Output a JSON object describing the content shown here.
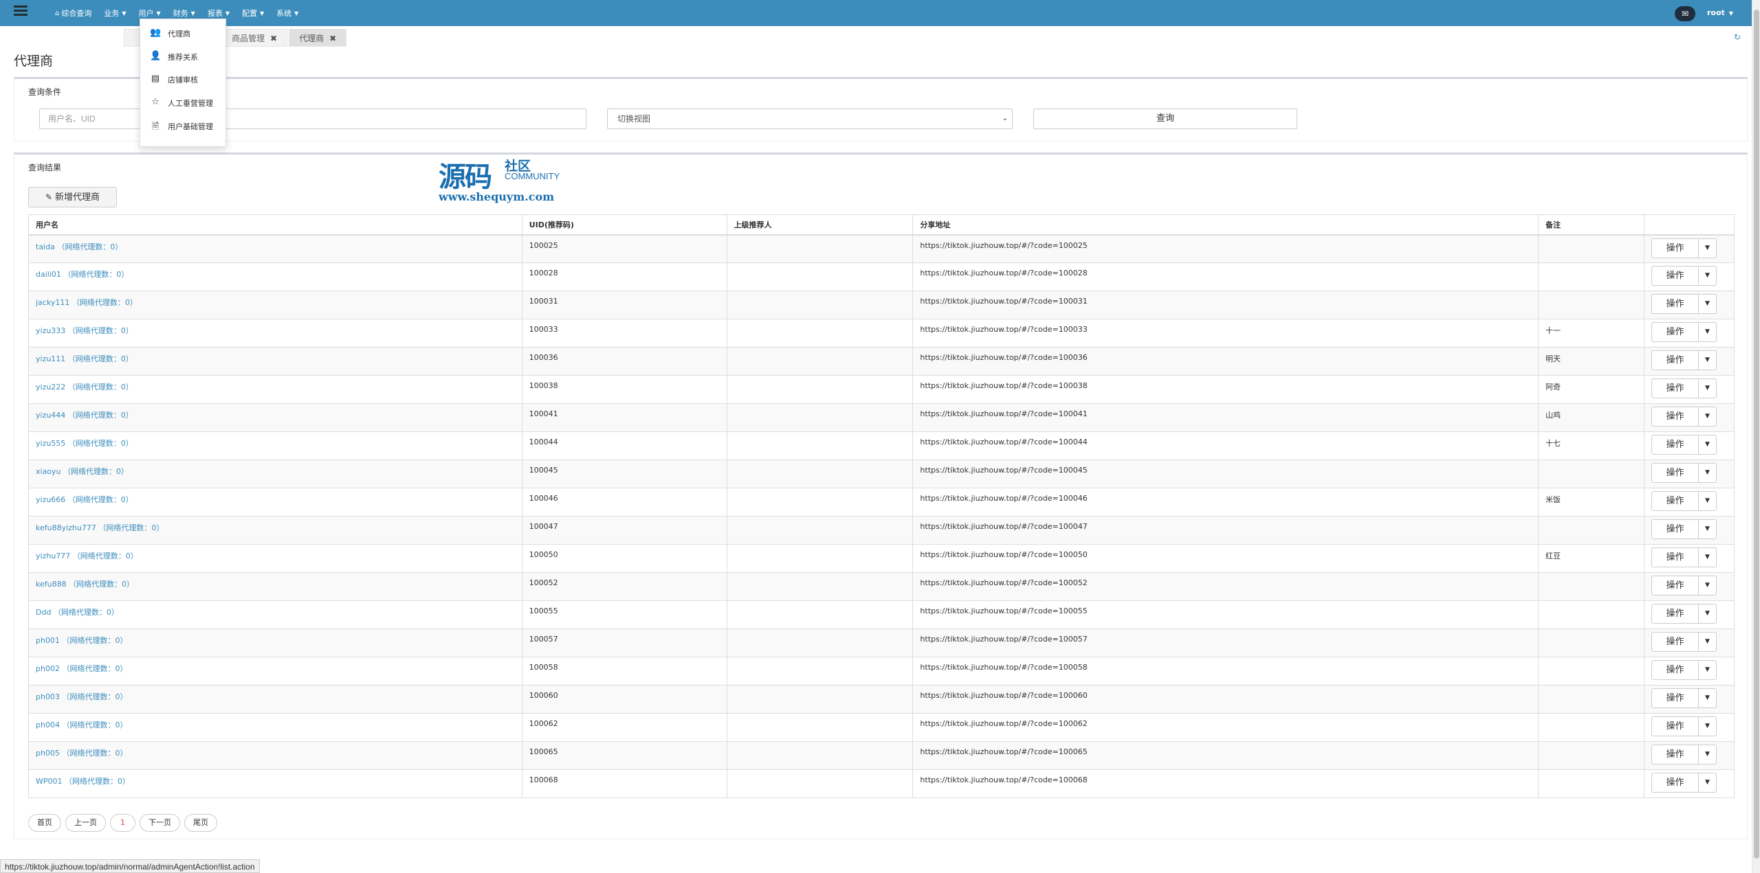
{
  "colors": {
    "topbar": "#3c8dbc",
    "link": "#3c8dbc",
    "current_page": "#e84a3d"
  },
  "topbar": {
    "menu": [
      {
        "label": "综合查询",
        "icon": "home-icon"
      },
      {
        "label": "业务"
      },
      {
        "label": "用户"
      },
      {
        "label": "财务"
      },
      {
        "label": "报表"
      },
      {
        "label": "配置"
      },
      {
        "label": "系统"
      }
    ],
    "user": "root"
  },
  "tabs": [
    {
      "label": "商品管理"
    },
    {
      "label": "代理商"
    }
  ],
  "dropdown": [
    {
      "label": "代理商",
      "icon": "users-icon"
    },
    {
      "label": "推荐关系",
      "icon": "user-icon"
    },
    {
      "label": "店铺审核",
      "icon": "card-icon"
    },
    {
      "label": "人工垂营管理",
      "icon": "star-icon"
    },
    {
      "label": "用户基础管理",
      "icon": "file-icon"
    }
  ],
  "page_title": "代理商",
  "search": {
    "title": "查询条件",
    "placeholder": "用户名、UID",
    "select_value": "切换视图",
    "query_label": "查询"
  },
  "results": {
    "title": "查询结果",
    "add_label": "新增代理商",
    "columns": [
      "用户名",
      "UID(推荐码)",
      "上级推荐人",
      "分享地址",
      "备注",
      ""
    ],
    "op_label": "操作",
    "rows": [
      {
        "name": "taida （网络代理数：0）",
        "uid": "100025",
        "parent": "",
        "url": "https://tiktok.jiuzhouw.top/#/?code=100025",
        "note": ""
      },
      {
        "name": "daili01 （网络代理数：0）",
        "uid": "100028",
        "parent": "",
        "url": "https://tiktok.jiuzhouw.top/#/?code=100028",
        "note": ""
      },
      {
        "name": "jacky111 （网络代理数：0）",
        "uid": "100031",
        "parent": "",
        "url": "https://tiktok.jiuzhouw.top/#/?code=100031",
        "note": ""
      },
      {
        "name": "yizu333 （网络代理数：0）",
        "uid": "100033",
        "parent": "",
        "url": "https://tiktok.jiuzhouw.top/#/?code=100033",
        "note": "十一"
      },
      {
        "name": "yizu111 （网络代理数：0）",
        "uid": "100036",
        "parent": "",
        "url": "https://tiktok.jiuzhouw.top/#/?code=100036",
        "note": "明天"
      },
      {
        "name": "yizu222 （网络代理数：0）",
        "uid": "100038",
        "parent": "",
        "url": "https://tiktok.jiuzhouw.top/#/?code=100038",
        "note": "阿奇"
      },
      {
        "name": "yizu444 （网络代理数：0）",
        "uid": "100041",
        "parent": "",
        "url": "https://tiktok.jiuzhouw.top/#/?code=100041",
        "note": "山鸡"
      },
      {
        "name": "yizu555 （网络代理数：0）",
        "uid": "100044",
        "parent": "",
        "url": "https://tiktok.jiuzhouw.top/#/?code=100044",
        "note": "十七"
      },
      {
        "name": "xiaoyu （网络代理数：0）",
        "uid": "100045",
        "parent": "",
        "url": "https://tiktok.jiuzhouw.top/#/?code=100045",
        "note": ""
      },
      {
        "name": "yizu666 （网络代理数：0）",
        "uid": "100046",
        "parent": "",
        "url": "https://tiktok.jiuzhouw.top/#/?code=100046",
        "note": "米饭"
      },
      {
        "name": "kefu88yizhu777 （网络代理数：0）",
        "uid": "100047",
        "parent": "",
        "url": "https://tiktok.jiuzhouw.top/#/?code=100047",
        "note": ""
      },
      {
        "name": "yizhu777 （网络代理数：0）",
        "uid": "100050",
        "parent": "",
        "url": "https://tiktok.jiuzhouw.top/#/?code=100050",
        "note": "红豆"
      },
      {
        "name": "kefu888 （网络代理数：0）",
        "uid": "100052",
        "parent": "",
        "url": "https://tiktok.jiuzhouw.top/#/?code=100052",
        "note": ""
      },
      {
        "name": "Ddd （网络代理数：0）",
        "uid": "100055",
        "parent": "",
        "url": "https://tiktok.jiuzhouw.top/#/?code=100055",
        "note": ""
      },
      {
        "name": "ph001 （网络代理数：0）",
        "uid": "100057",
        "parent": "",
        "url": "https://tiktok.jiuzhouw.top/#/?code=100057",
        "note": ""
      },
      {
        "name": "ph002 （网络代理数：0）",
        "uid": "100058",
        "parent": "",
        "url": "https://tiktok.jiuzhouw.top/#/?code=100058",
        "note": ""
      },
      {
        "name": "ph003 （网络代理数：0）",
        "uid": "100060",
        "parent": "",
        "url": "https://tiktok.jiuzhouw.top/#/?code=100060",
        "note": ""
      },
      {
        "name": "ph004 （网络代理数：0）",
        "uid": "100062",
        "parent": "",
        "url": "https://tiktok.jiuzhouw.top/#/?code=100062",
        "note": ""
      },
      {
        "name": "ph005 （网络代理数：0）",
        "uid": "100065",
        "parent": "",
        "url": "https://tiktok.jiuzhouw.top/#/?code=100065",
        "note": ""
      },
      {
        "name": "WP001 （网络代理数：0）",
        "uid": "100068",
        "parent": "",
        "url": "https://tiktok.jiuzhouw.top/#/?code=100068",
        "note": ""
      }
    ]
  },
  "pager": {
    "first": "首页",
    "prev": "上一页",
    "current": "1",
    "next": "下一页",
    "last": "尾页"
  },
  "watermark": {
    "big": "源码",
    "small": "社区",
    "community": "COMMUNITY",
    "url": "www.shequym.com"
  },
  "status_url": "https://tiktok.jiuzhouw.top/admin/normal/adminAgentAction!list.action"
}
